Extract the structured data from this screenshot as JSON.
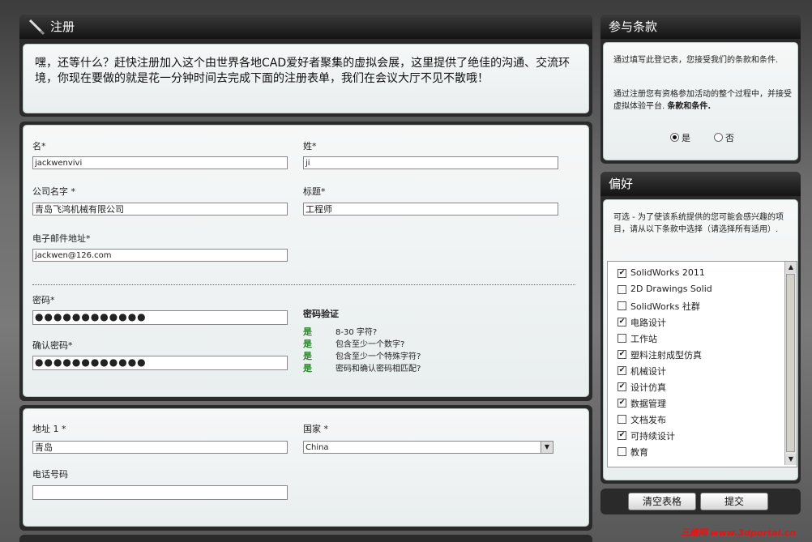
{
  "register": {
    "title": "注册",
    "intro": "嘿，还等什么？赶快注册加入这个由世界各地CAD爱好者聚集的虚拟会展，这里提供了绝佳的沟通、交流环境，你现在要做的就是花一分钟时间去完成下面的注册表单，我们在会议大厅不见不散哦！"
  },
  "form1": {
    "first_name_label": "名*",
    "first_name_value": "jackwenvivi",
    "last_name_label": "姓*",
    "last_name_value": "ji",
    "company_label": "公司名字 *",
    "company_value": "青岛飞鸿机械有限公司",
    "title_label": "标题*",
    "title_value": "工程师",
    "email_label": "电子邮件地址*",
    "email_value": "jackwen@126.com",
    "password_label": "密码*",
    "password_value": "●●●●●●●●●●●●",
    "confirm_label": "确认密码*",
    "confirm_value": "●●●●●●●●●●●●",
    "validation_title": "密码验证",
    "validation": [
      {
        "status": "是",
        "text": "8-30 字符?"
      },
      {
        "status": "是",
        "text": "包含至少一个数字?"
      },
      {
        "status": "是",
        "text": "包含至少一个特殊字符?"
      },
      {
        "status": "是",
        "text": "密码和确认密码相匹配?"
      }
    ]
  },
  "form2": {
    "address_label": "地址 1 *",
    "address_value": "青岛",
    "country_label": "国家 *",
    "country_value": "China",
    "phone_label": "电话号码",
    "phone_value": ""
  },
  "terms": {
    "title": "参与条款",
    "p1": "通过填写此登记表，您接受我们的条款和条件.",
    "p2a": "通过注册您有资格参加活动的整个过程中，并接受虚拟体验平台.",
    "p2b": "条款和条件.",
    "yes_label": "是",
    "no_label": "否"
  },
  "prefs": {
    "title": "偏好",
    "desc": "可选 - 为了使该系统提供的您可能会感兴趣的项目，请从以下条款中选择（请选择所有适用）.",
    "items": [
      {
        "label": "SolidWorks 2011",
        "checked": true
      },
      {
        "label": "2D Drawings Solid",
        "checked": false
      },
      {
        "label": "SolidWorks 社群",
        "checked": false
      },
      {
        "label": "电路设计",
        "checked": true
      },
      {
        "label": "工作站",
        "checked": false
      },
      {
        "label": "塑料注射成型仿真",
        "checked": true
      },
      {
        "label": "机械设计",
        "checked": true
      },
      {
        "label": "设计仿真",
        "checked": true
      },
      {
        "label": "数据管理",
        "checked": true
      },
      {
        "label": "文档发布",
        "checked": false
      },
      {
        "label": "可持续设计",
        "checked": true
      },
      {
        "label": "教育",
        "checked": false
      }
    ]
  },
  "buttons": {
    "clear": "清空表格",
    "submit": "提交"
  },
  "watermark": "三维网 www.3dportal.cn"
}
